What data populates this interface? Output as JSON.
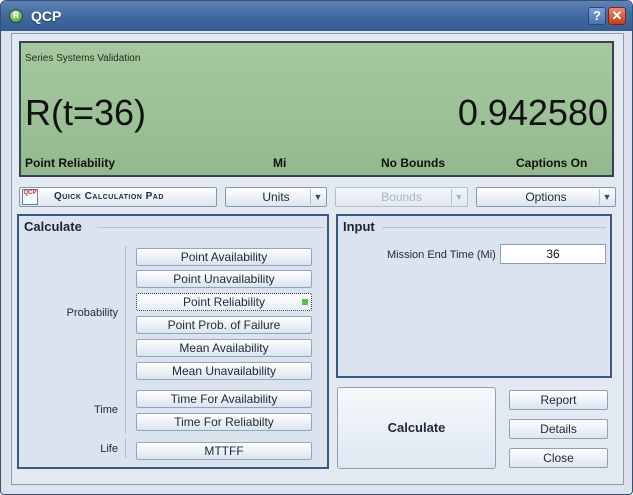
{
  "window": {
    "title": "QCP"
  },
  "display": {
    "title": "Series Systems Validation",
    "expression": "R(t=36)",
    "value": "0.942580",
    "status": [
      "Point Reliability",
      "Mi",
      "No Bounds",
      "Captions On"
    ],
    "background_color": "#9dc297"
  },
  "toolbar": {
    "qcp_logo_text": "QCP",
    "qcp_label": "Quick Calculation Pad",
    "units_label": "Units",
    "bounds_label": "Bounds",
    "options_label": "Options"
  },
  "calculate": {
    "title": "Calculate",
    "groups": {
      "probability": "Probability",
      "time": "Time",
      "life": "Life"
    },
    "buttons": [
      "Point Availability",
      "Point Unavailability",
      "Point Reliability",
      "Point Prob. of Failure",
      "Mean Availability",
      "Mean Unavailability",
      "Time For Availability",
      "Time For Reliabilty",
      "MTTFF"
    ],
    "selected": "Point Reliability"
  },
  "input": {
    "title": "Input",
    "mission_label": "Mission End Time (Mi)",
    "mission_value": "36"
  },
  "actions": {
    "calculate": "Calculate",
    "report": "Report",
    "details": "Details",
    "close": "Close"
  }
}
